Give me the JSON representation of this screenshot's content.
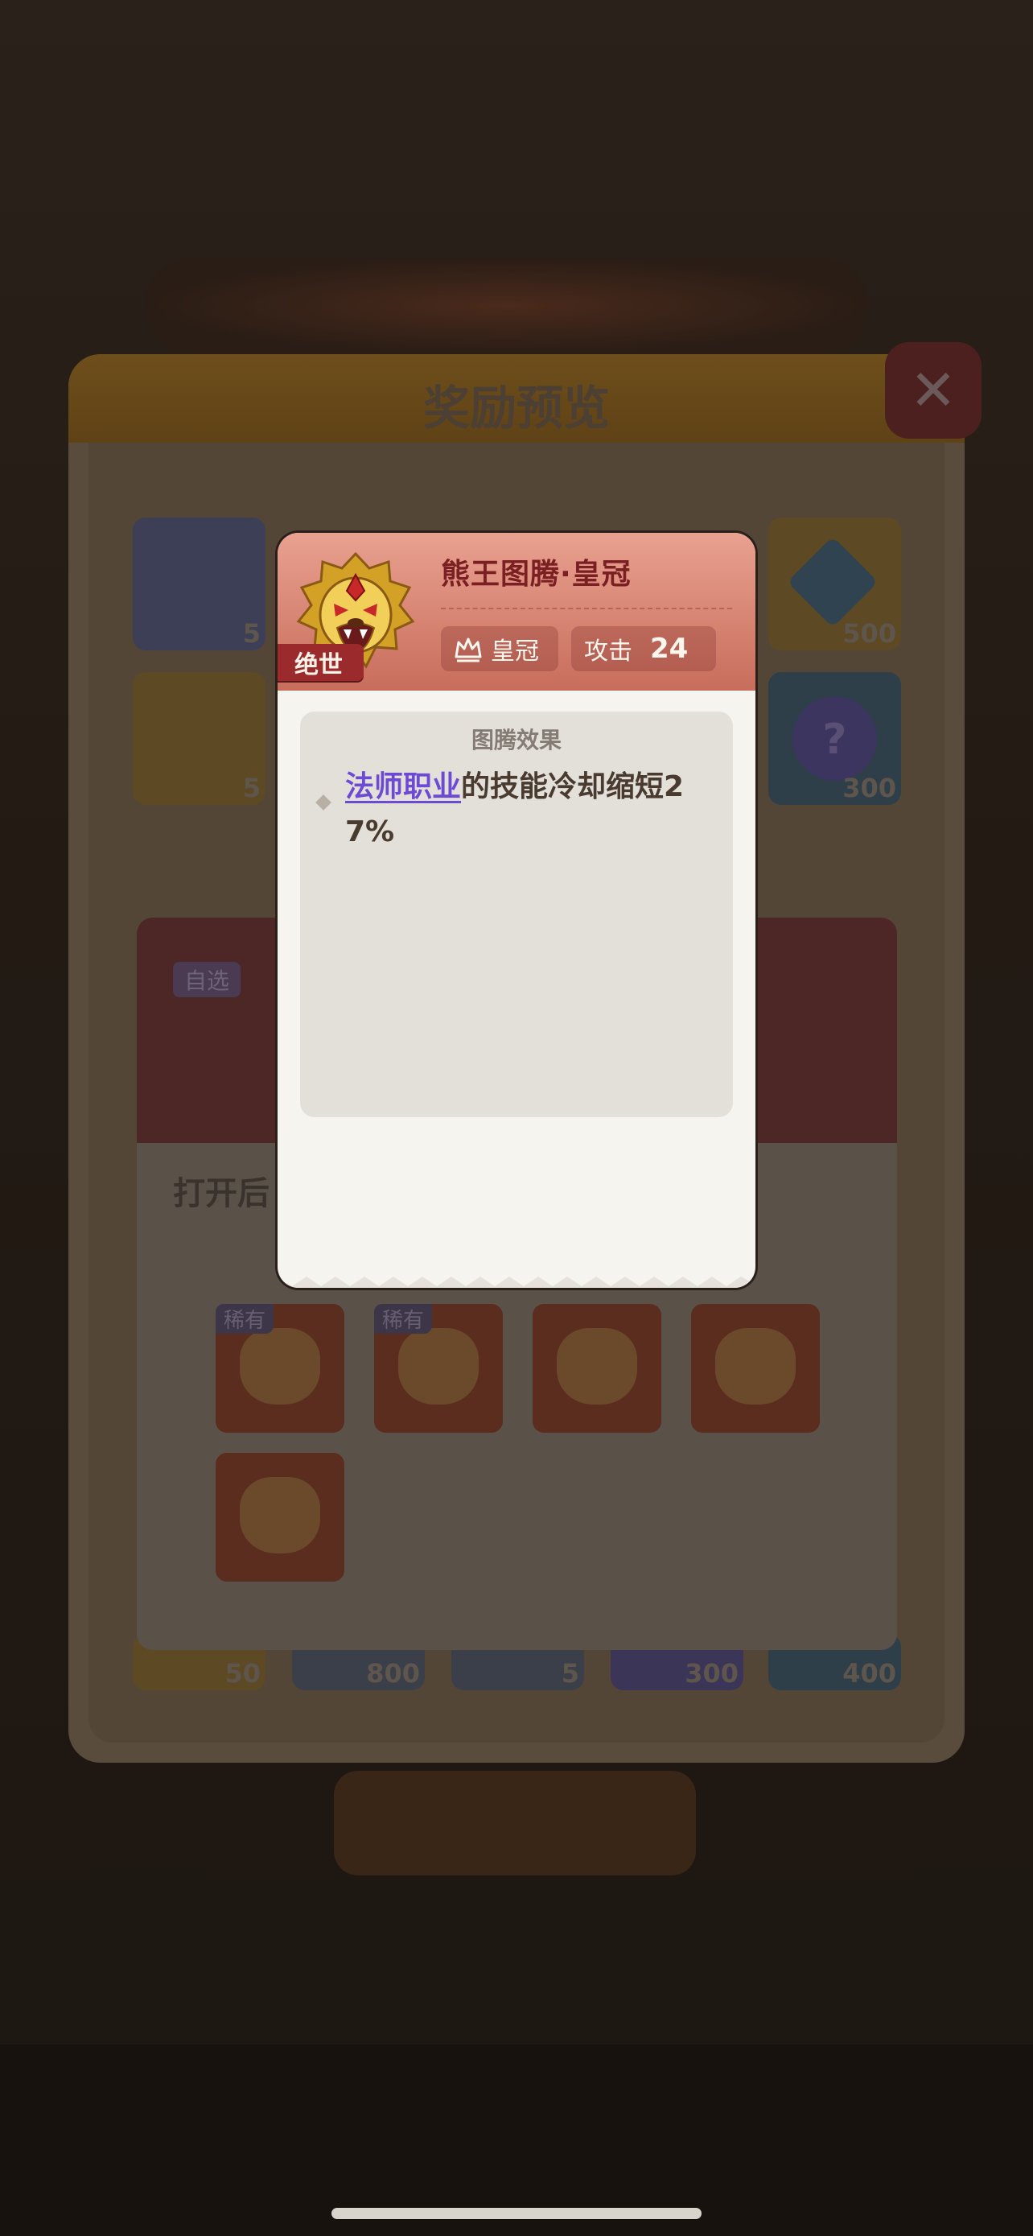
{
  "background": {
    "subtitle": "",
    "panel": {
      "title": "奖励预览",
      "close_icon": "close-icon",
      "rewards_row1": [
        {
          "name": "hero-card",
          "count": "5"
        },
        {
          "name": "diamond",
          "count": "500"
        }
      ],
      "rewards_row2": [
        {
          "name": "spinning-top",
          "count": "5"
        },
        {
          "name": "key-orb",
          "count": "300"
        }
      ],
      "rewards_bottom": [
        {
          "count": "50"
        },
        {
          "count": "800"
        },
        {
          "count": "5"
        },
        {
          "count": "300"
        },
        {
          "count": "400"
        }
      ],
      "card": {
        "badge": "自选",
        "text": "打开后",
        "rare_label": "稀有"
      }
    }
  },
  "popup": {
    "grade": "绝世",
    "name": "熊王图腾·皇冠",
    "crown_label": "皇冠",
    "attack_label": "攻击",
    "attack_value": "24",
    "effect_title": "图腾效果",
    "effect_highlight": "法师职业",
    "effect_text": "的技能冷却缩短27%"
  },
  "colors": {
    "popup_header": "#c86d5c",
    "grade_badge": "#9b2a2c",
    "highlight": "#6d4ad4",
    "effect_bg": "#e3e0da"
  }
}
